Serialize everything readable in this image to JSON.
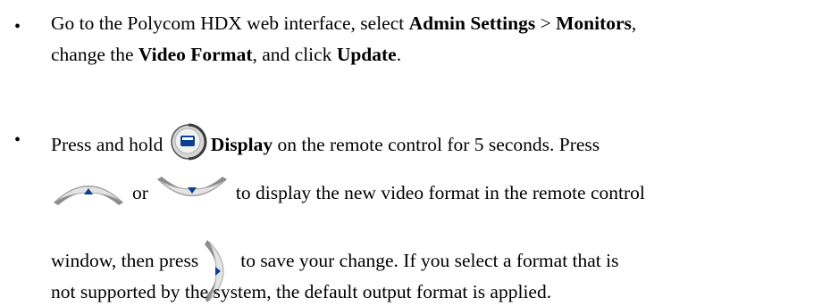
{
  "bullets": {
    "glyph": "•"
  },
  "para1": {
    "t1": "Go to the Polycom HDX web interface, select ",
    "admin_settings": "Admin Settings",
    "sep": " > ",
    "monitors": "Monitors",
    "comma": ",",
    "t2": "change the ",
    "video_format": "Video Format",
    "t3": ", and click ",
    "update": "Update",
    "period": "."
  },
  "para2": {
    "t1": "Press and hold ",
    "display": "Display",
    "t2": " on the remote control for 5 seconds. Press",
    "t3": "or",
    "t4": "to display the new video format in the remote control",
    "t5": "window, then press",
    "t6": "to save your change. If you select a format that is",
    "t7": "not supported by the system, the default output format is applied."
  },
  "icons": {
    "display_button": "display-icon",
    "up_button": "arrow-up-icon",
    "down_button": "arrow-down-icon",
    "right_button": "arrow-right-icon",
    "accent": "#0b3f8f",
    "button_face": "#e6e6e6",
    "button_rim": "#9a9a9a"
  }
}
